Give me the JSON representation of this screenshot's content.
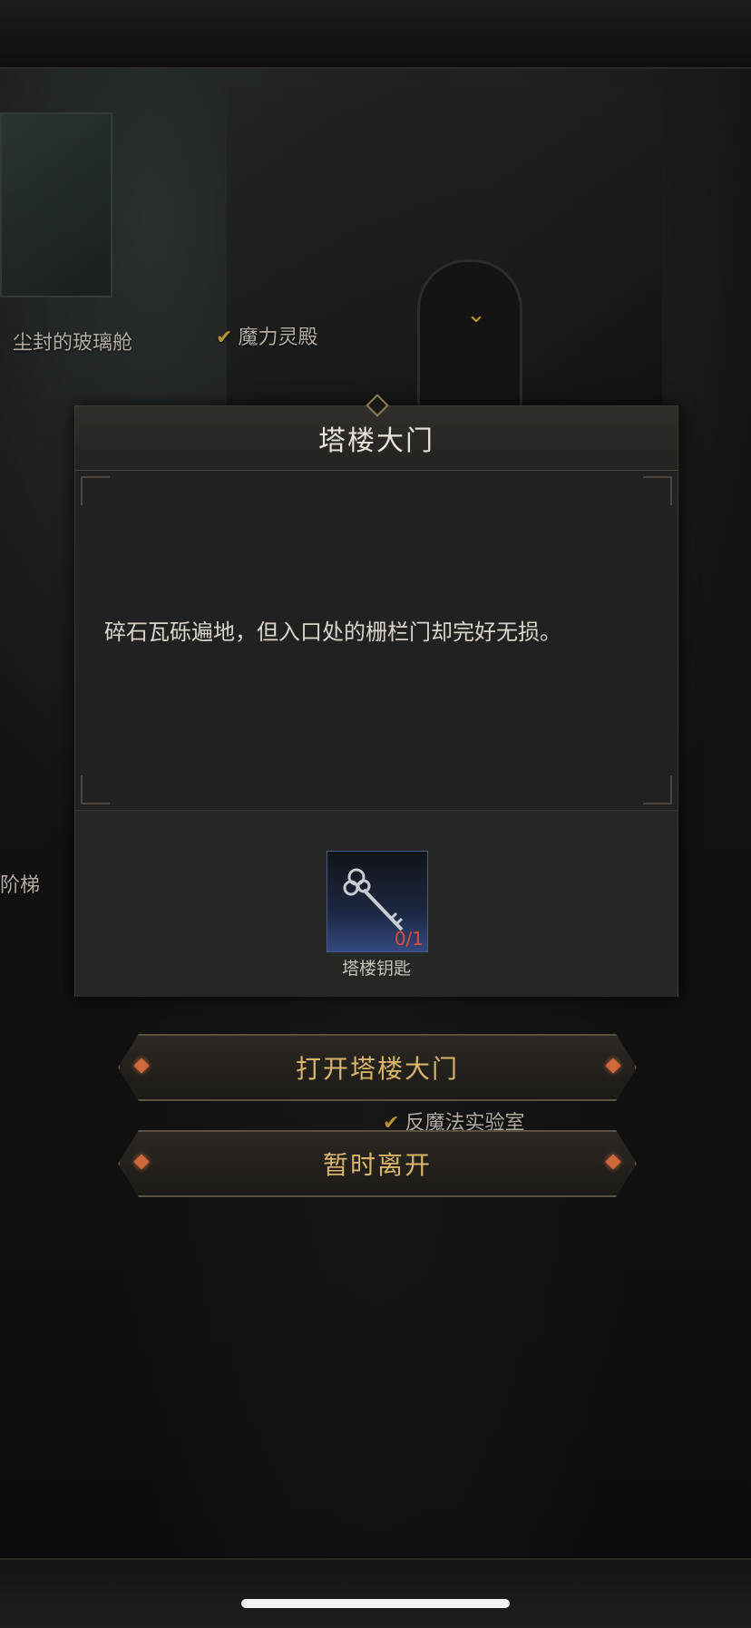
{
  "map": {
    "labels": {
      "glass_chamber": "尘封的玻璃舱",
      "magic_hall": "魔力灵殿",
      "stairs": "阶梯",
      "anti_magic_lab": "反魔法实验室"
    }
  },
  "dialog": {
    "title": "塔楼大门",
    "message": "碎石瓦砾遍地，但入口处的栅栏门却完好无损。",
    "item": {
      "name": "塔楼钥匙",
      "count": "0/1",
      "icon": "key-icon"
    }
  },
  "actions": {
    "open_label": "打开塔楼大门",
    "leave_label": "暂时离开"
  },
  "colors": {
    "accent_gold": "#d9b56a",
    "count_red": "#e24a3b",
    "check_gold": "#b8922f"
  }
}
